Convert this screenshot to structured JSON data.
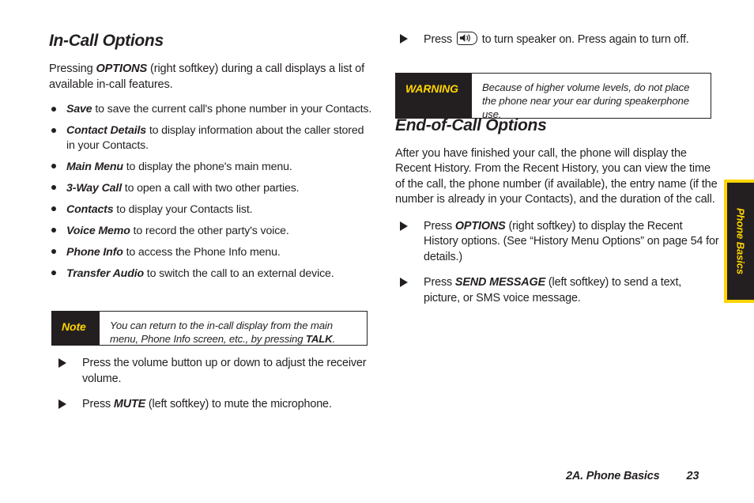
{
  "left_column": {
    "heading": "In-Call Options",
    "intro": {
      "pre": "Pressing ",
      "emphasis": "OPTIONS",
      "post": " (right softkey) during a call displays a list of available in-call features."
    },
    "options": [
      {
        "label": "Save",
        "text": " to save the current call's phone number in your Contacts."
      },
      {
        "label": "Contact Details",
        "text": " to display information about the caller stored in your Contacts."
      },
      {
        "label": "Main Menu",
        "text": " to display the phone's main menu."
      },
      {
        "label": "3-Way Call",
        "text": " to open a call with two other parties."
      },
      {
        "label": "Contacts",
        "text": " to display your Contacts list."
      },
      {
        "label": "Voice Memo",
        "text": " to record the other party's voice."
      },
      {
        "label": "Phone Info",
        "text": " to access the Phone Info menu."
      },
      {
        "label": "Transfer Audio",
        "text": " to switch the call to an external device."
      }
    ],
    "note": {
      "tag": "Note",
      "pre": "You can return to the in-call display from the main menu, Phone Info screen, etc., by pressing ",
      "emphasis": "TALK",
      "post": "."
    },
    "steps": [
      {
        "pre": "Press the volume button up or down to adjust the receiver volume.",
        "emphasis": "",
        "post": ""
      },
      {
        "pre": "Press ",
        "emphasis": "MUTE",
        "post": " (left softkey) to mute the microphone."
      }
    ]
  },
  "right_column": {
    "speaker_step": {
      "pre": "Press ",
      "icon": "speaker-key-icon",
      "post": " to turn speaker on. Press again to turn off."
    },
    "warning": {
      "tag": "WARNING",
      "text": "Because of higher volume levels, do not place the phone near your ear during speakerphone use."
    },
    "heading": "End-of-Call Options",
    "intro": "After you have finished your call, the phone will display the Recent History. From the Recent History, you can view the time of the call, the phone number (if available), the entry name (if the number is already in your Contacts), and the duration of the call.",
    "steps": [
      {
        "pre": "Press ",
        "emphasis": "OPTIONS",
        "post": " (right softkey) to display the Recent History options. (See “History Menu Options” on page 54 for details.)"
      },
      {
        "pre": "Press ",
        "emphasis": "SEND MESSAGE",
        "post": " (left softkey) to send a text, picture, or SMS voice message."
      }
    ]
  },
  "side_tab": {
    "label": "Phone Basics"
  },
  "footer": {
    "chapter": "2A. Phone Basics",
    "page": "23"
  },
  "colors": {
    "accent_yellow": "#ffd400",
    "ink": "#231f20",
    "paper": "#ffffff"
  }
}
